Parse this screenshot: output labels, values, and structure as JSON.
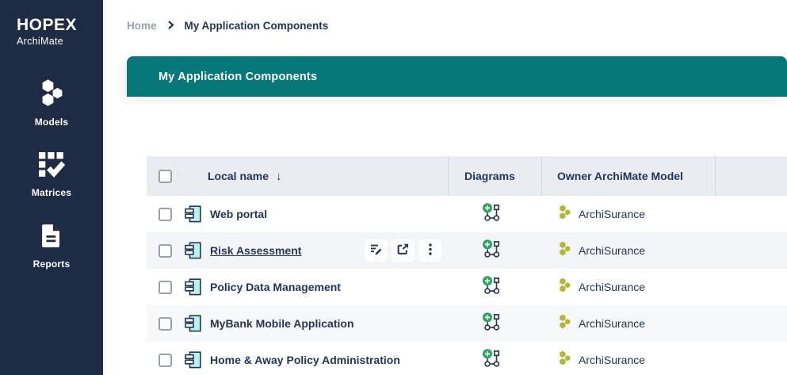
{
  "app": {
    "name": "HOPEX",
    "edition": "ArchiMate"
  },
  "sidebar": {
    "items": [
      {
        "label": "Models",
        "icon": "hexagon-cluster-icon"
      },
      {
        "label": "Matrices",
        "icon": "matrix-check-icon"
      },
      {
        "label": "Reports",
        "icon": "document-icon"
      }
    ]
  },
  "breadcrumb": {
    "items": [
      {
        "label": "Home"
      },
      {
        "label": "My Application Components"
      }
    ]
  },
  "panel": {
    "title": "My Application Components"
  },
  "table": {
    "columns": {
      "local_name": "Local name",
      "diagrams": "Diagrams",
      "owner": "Owner ArchiMate Model"
    },
    "sort": {
      "column": "Local name",
      "direction": "descending",
      "glyph": "↓"
    },
    "rows": [
      {
        "name": "Web portal",
        "owner": "ArchiSurance",
        "type_icon": "application-component-icon",
        "diagrams_icon": "diagram-icon",
        "owner_icon": "hexagon-cluster-icon",
        "state": "default"
      },
      {
        "name": "Risk Assessment",
        "owner": "ArchiSurance",
        "type_icon": "application-component-icon",
        "diagrams_icon": "diagram-icon",
        "owner_icon": "hexagon-cluster-icon",
        "state": "hovered"
      },
      {
        "name": "Policy Data Management",
        "owner": "ArchiSurance",
        "type_icon": "application-component-icon",
        "diagrams_icon": "diagram-icon",
        "owner_icon": "hexagon-cluster-icon",
        "state": "default"
      },
      {
        "name": "MyBank Mobile Application",
        "owner": "ArchiSurance",
        "type_icon": "application-component-icon",
        "diagrams_icon": "diagram-icon",
        "owner_icon": "hexagon-cluster-icon",
        "state": "default"
      },
      {
        "name": "Home & Away Policy Administration",
        "owner": "ArchiSurance",
        "type_icon": "application-component-icon",
        "diagrams_icon": "diagram-icon",
        "owner_icon": "hexagon-cluster-icon",
        "state": "default"
      }
    ],
    "hover_actions": [
      {
        "name": "edit",
        "icon": "edit-icon"
      },
      {
        "name": "open-in-new-window",
        "icon": "open-in-new-icon"
      },
      {
        "name": "more-options",
        "icon": "kebab-menu-icon"
      }
    ]
  },
  "colors": {
    "sidebar_bg": "#1e2b44",
    "teal_header": "#077879",
    "text_navy": "#22355a",
    "table_header_bg": "#e9edf2",
    "alt_row_bg": "#f7f8fa",
    "component_fill": "#baf2ee",
    "owner_icon_olive": "#b3b735",
    "diagram_green": "#27a65a",
    "breadcrumb_inactive": "#9aa1ab"
  }
}
